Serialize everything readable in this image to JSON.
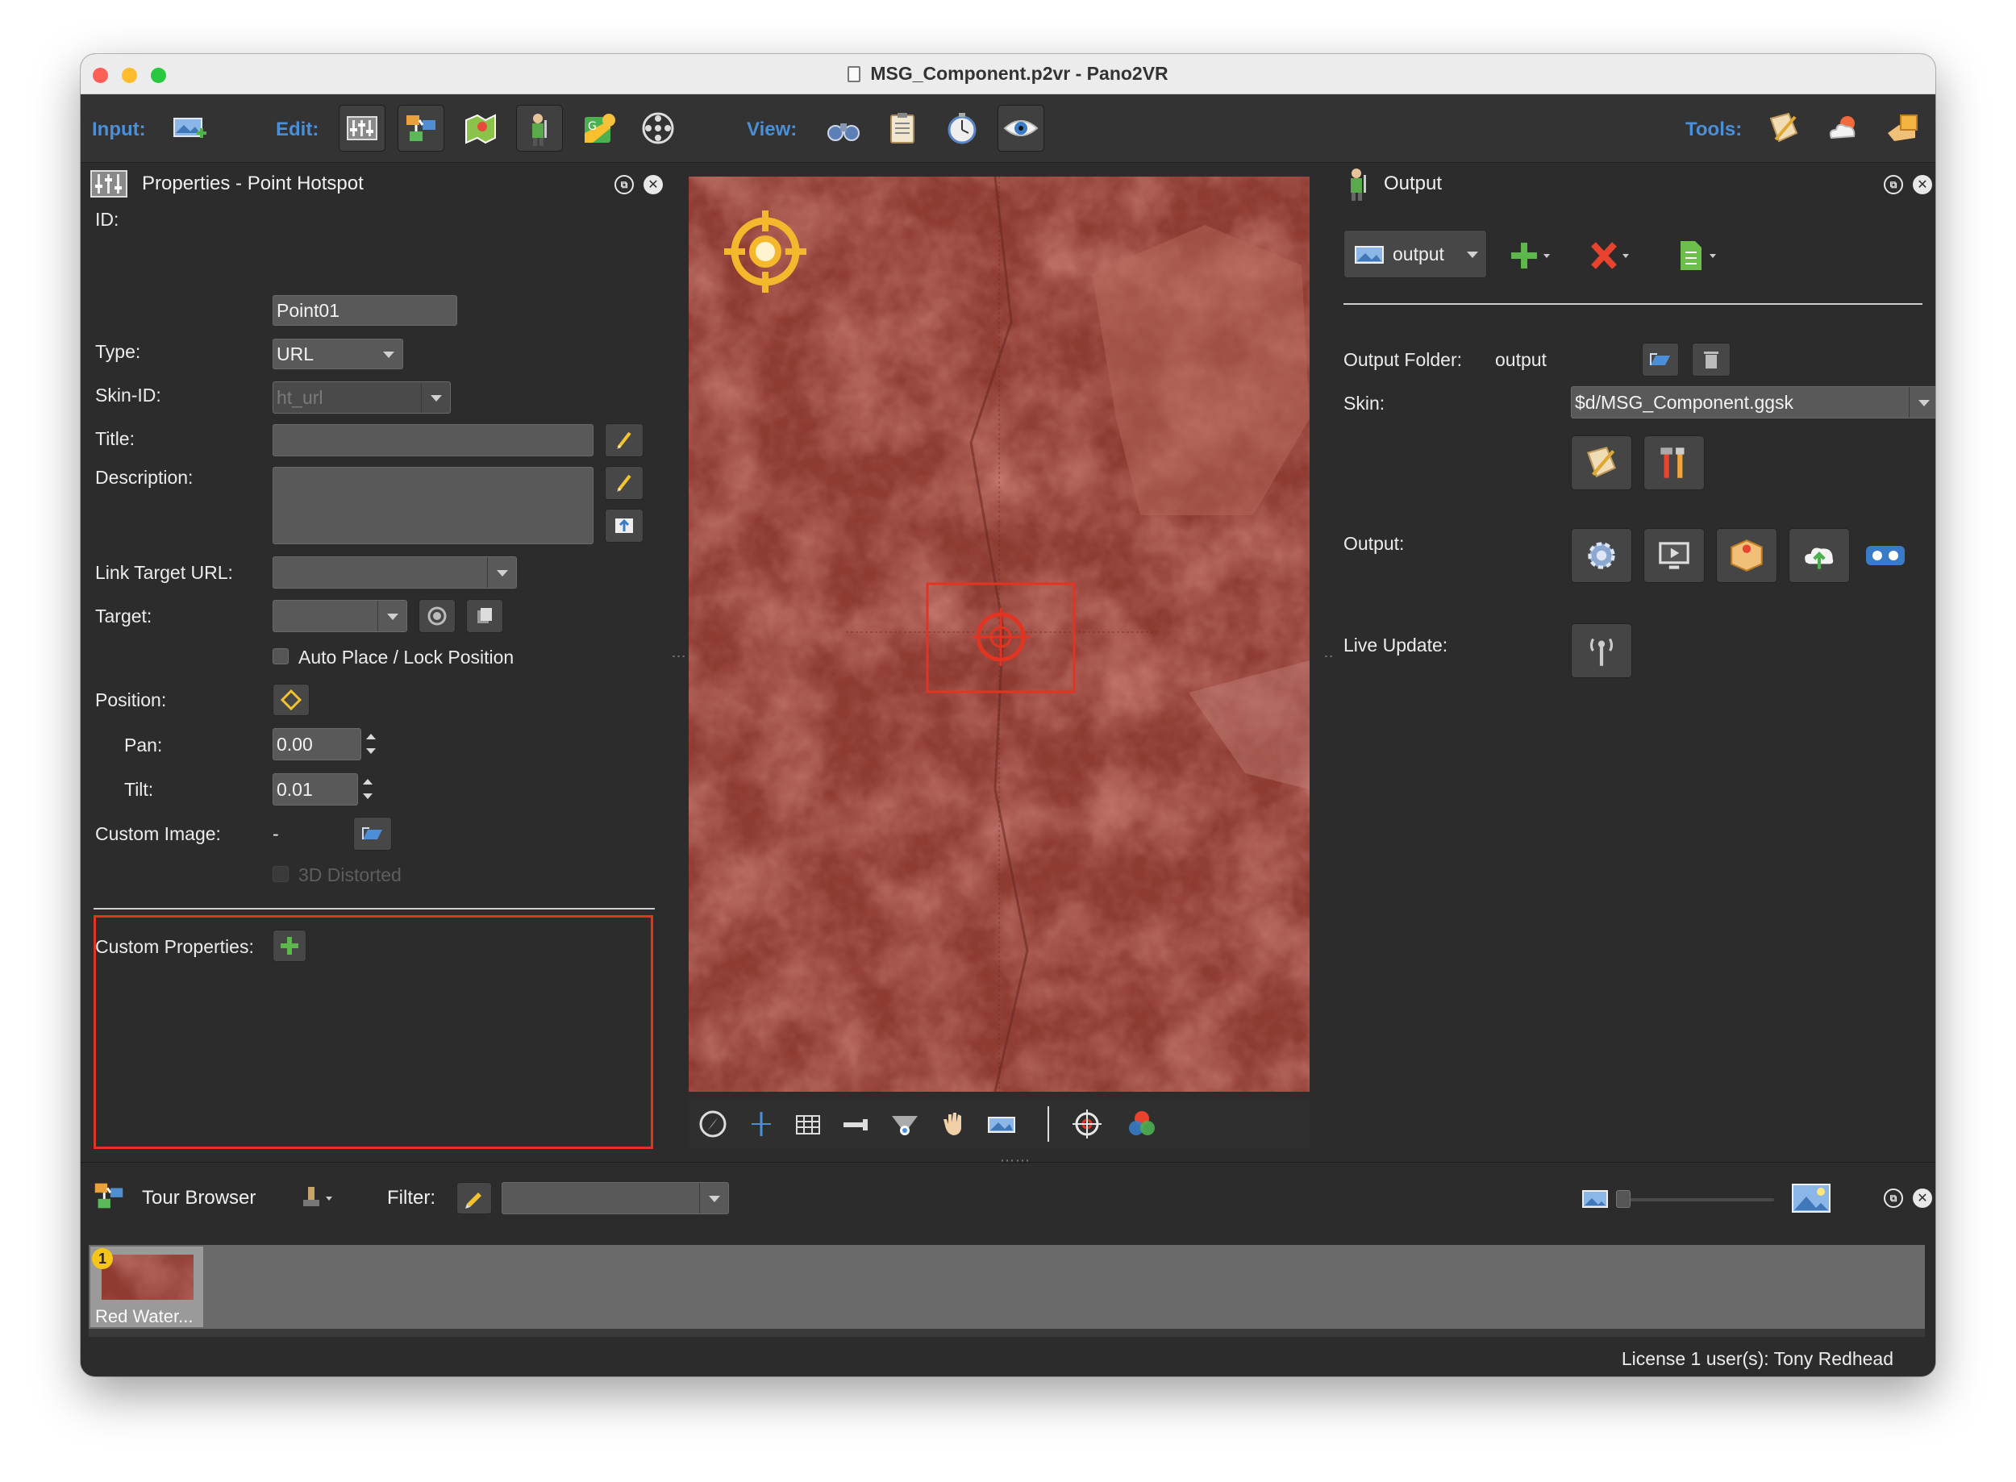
{
  "window": {
    "title": "MSG_Component.p2vr - Pano2VR"
  },
  "toolbar": {
    "input_label": "Input:",
    "edit_label": "Edit:",
    "view_label": "View:",
    "tools_label": "Tools:"
  },
  "properties": {
    "title": "Properties - Point Hotspot",
    "id_label": "ID:",
    "id_value": "Point01",
    "type_label": "Type:",
    "type_value": "URL",
    "skin_id_label": "Skin-ID:",
    "skin_id_value": "ht_url",
    "title_label": "Title:",
    "title_value": "",
    "description_label": "Description:",
    "description_value": "",
    "link_target_label": "Link Target URL:",
    "link_target_value": "",
    "target_label": "Target:",
    "target_value": "",
    "auto_place_label": "Auto Place / Lock Position",
    "position_label": "Position:",
    "pan_label": "Pan:",
    "pan_value": "0.00",
    "tilt_label": "Tilt:",
    "tilt_value": "0.01",
    "custom_image_label": "Custom Image:",
    "custom_image_value": "-",
    "distorted_label": "3D Distorted",
    "custom_properties_label": "Custom Properties:"
  },
  "output_panel": {
    "title": "Output",
    "output_select": "output",
    "output_folder_label": "Output Folder:",
    "output_folder_value": "output",
    "skin_label": "Skin:",
    "skin_value": "$d/MSG_Component.ggsk",
    "output_label": "Output:",
    "live_update_label": "Live Update:"
  },
  "tour_browser": {
    "title": "Tour Browser",
    "filter_label": "Filter:",
    "filter_value": "",
    "items": [
      {
        "badge": "1",
        "label": "Red Water..."
      }
    ]
  },
  "status_bar": {
    "license": "License 1 user(s): Tony Redhead"
  },
  "colors": {
    "accent_blue": "#4c8fd6",
    "highlight_red": "#e33422",
    "panel_bg": "#2c2c2c",
    "pano_red": "#8e3b32"
  }
}
